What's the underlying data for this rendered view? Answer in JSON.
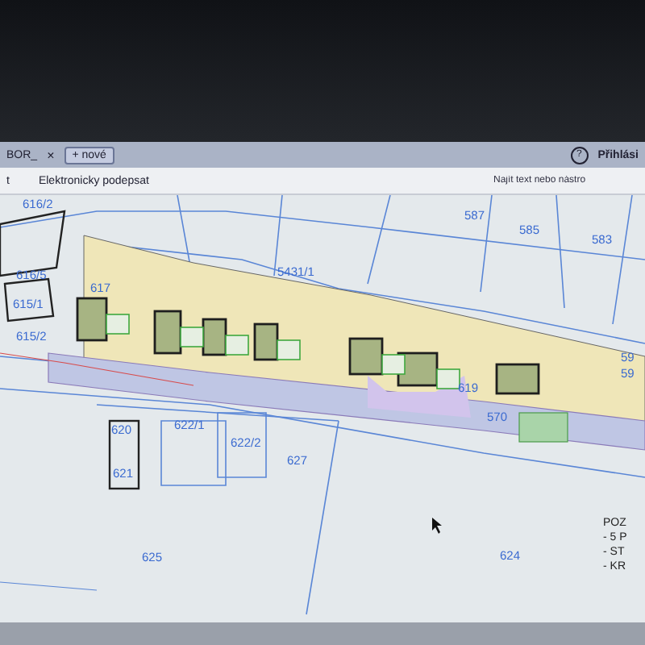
{
  "browser": {
    "tab": {
      "title": "BOR_",
      "close": "×"
    },
    "new_tab": "+ nové",
    "help": "?",
    "login": "Přihlási"
  },
  "toolbar": {
    "items": [
      {
        "label": "t"
      },
      {
        "label": "Elektronicky podepsat"
      }
    ],
    "search": {
      "placeholder": "Najít text nebo nástro"
    }
  },
  "plan": {
    "parcels": [
      "616/2",
      "616/5",
      "615/1",
      "615/2",
      "617",
      "5431/1",
      "587",
      "585",
      "583",
      "620",
      "622/1",
      "622/2",
      "627",
      "621",
      "625",
      "624",
      "619",
      "570",
      "59",
      "59"
    ],
    "legend": [
      "POZ",
      "- 5 P",
      "- ST",
      "- KR"
    ]
  }
}
